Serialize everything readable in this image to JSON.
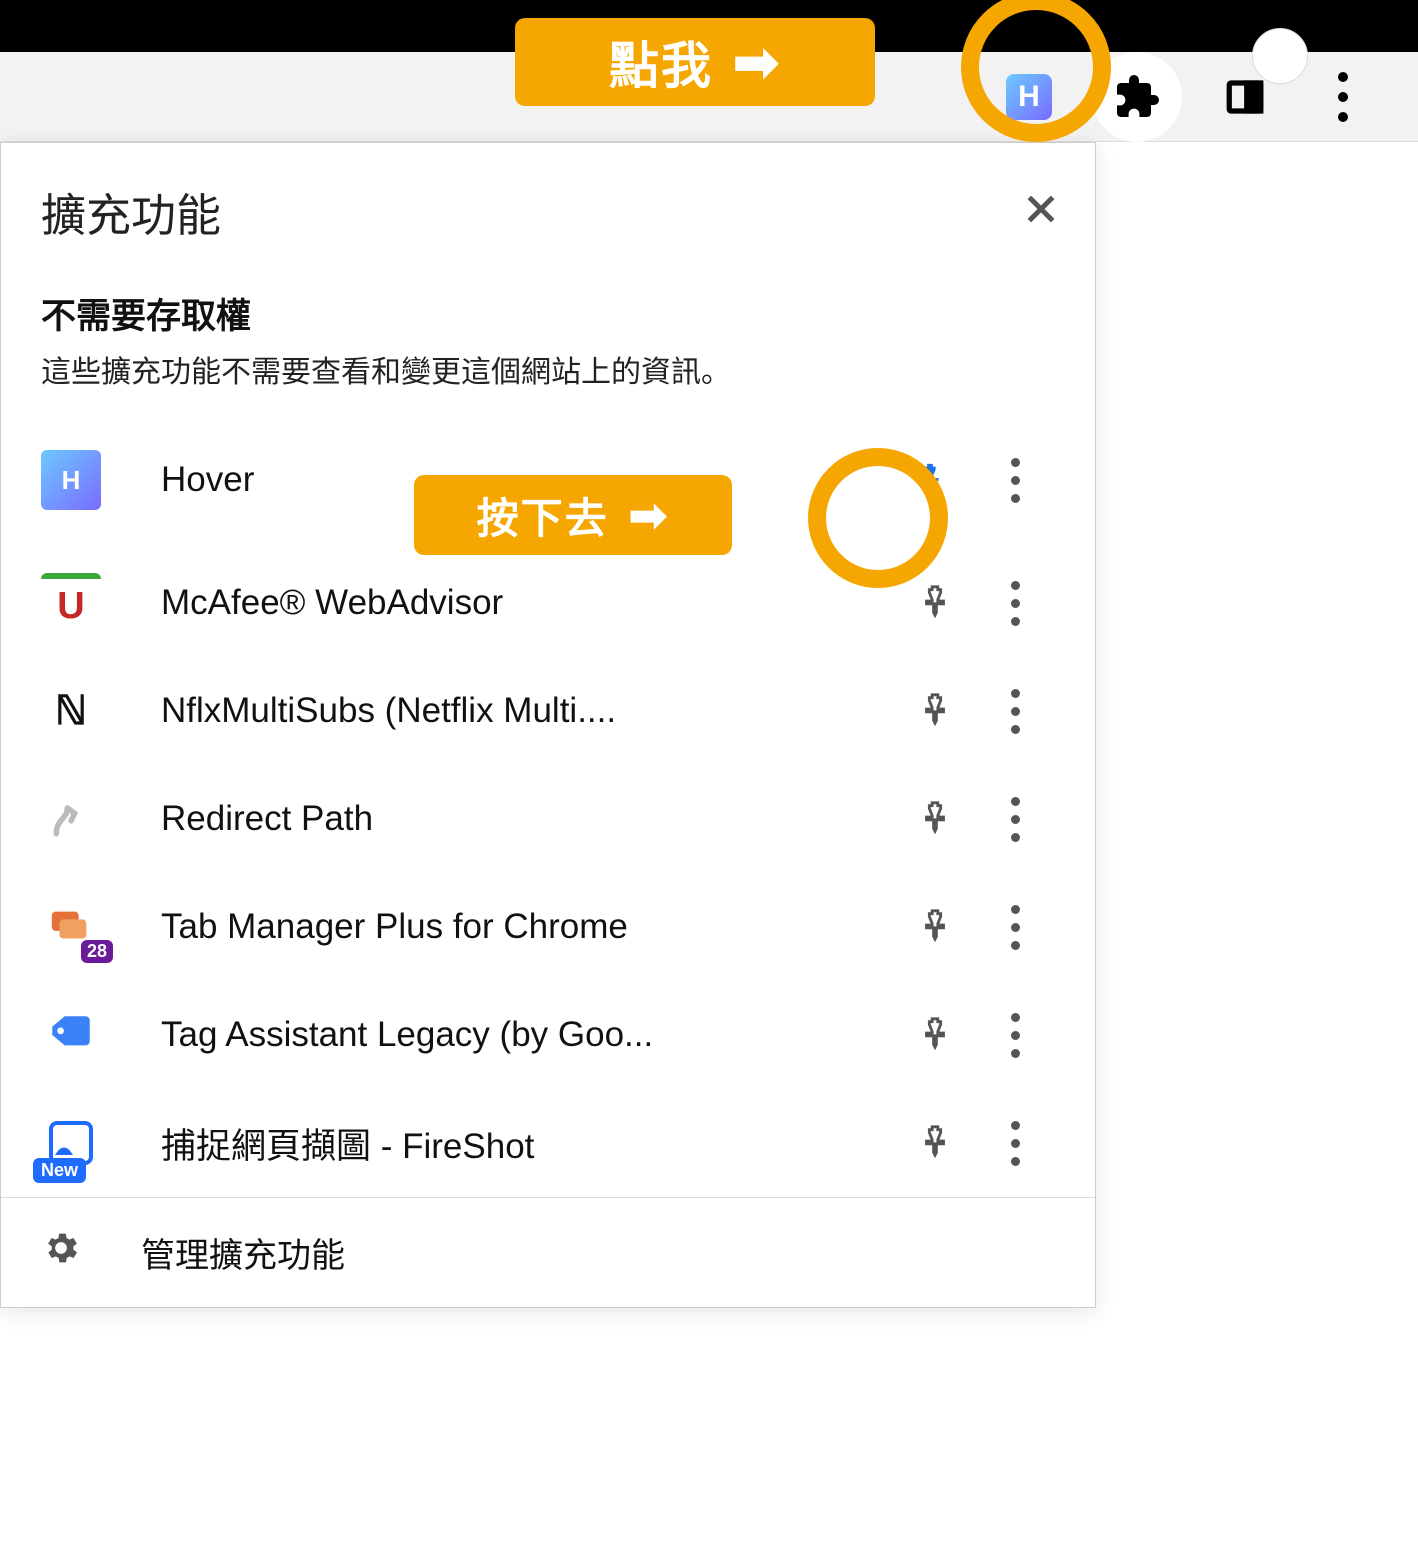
{
  "annotations": {
    "click_me_label": "點我",
    "press_it_label": "按下去"
  },
  "popup": {
    "title": "擴充功能",
    "section_heading": "不需要存取權",
    "section_sub": "這些擴充功能不需要查看和變更這個網站上的資訊。",
    "manage_label": "管理擴充功能"
  },
  "extensions": [
    {
      "name": "Hover",
      "pinned": true,
      "icon": "hover",
      "badge": ""
    },
    {
      "name": "McAfee® WebAdvisor",
      "pinned": false,
      "icon": "mcafee",
      "badge": ""
    },
    {
      "name": "NflxMultiSubs (Netflix Multi....",
      "pinned": false,
      "icon": "nflx",
      "badge": ""
    },
    {
      "name": "Redirect Path",
      "pinned": false,
      "icon": "redirect",
      "badge": ""
    },
    {
      "name": "Tab Manager Plus for Chrome",
      "pinned": false,
      "icon": "tabmgr",
      "badge": "28"
    },
    {
      "name": "Tag Assistant Legacy (by Goo...",
      "pinned": false,
      "icon": "tag",
      "badge": ""
    },
    {
      "name": "捕捉網頁擷圖 - FireShot",
      "pinned": false,
      "icon": "fireshot",
      "badge": "New"
    }
  ]
}
